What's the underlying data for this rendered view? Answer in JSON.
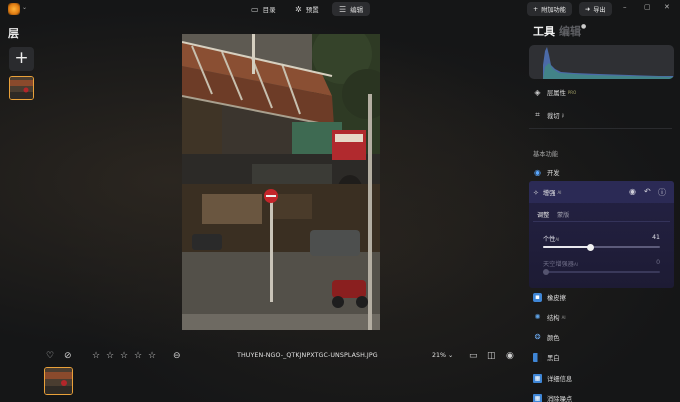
{
  "topbar": {
    "nav": [
      {
        "label": "目录",
        "icon": "catalog-icon"
      },
      {
        "label": "预置",
        "icon": "presets-icon"
      },
      {
        "label": "编辑",
        "icon": "edit-icon"
      }
    ],
    "addon_label": "附加功能",
    "export_label": "导出"
  },
  "left": {
    "title": "层"
  },
  "bottom": {
    "filename": "THUYEN-NGO-_QTKJNPXTGC-UNSPLASH.JPG",
    "zoom": "21% ⌄",
    "stars": 0
  },
  "right": {
    "tab_tools": "工具",
    "tab_edits": "编辑",
    "rows": [
      {
        "label": "层属性",
        "tag": "PRO"
      },
      {
        "label": "裁切",
        "tag": "β"
      }
    ],
    "section": "基本功能",
    "develop": "开发",
    "panel": {
      "title": "增强",
      "tag": "AI",
      "subtabs": [
        "调整",
        "蒙版"
      ],
      "sliders": [
        {
          "label": "个性",
          "tag": "AI",
          "value": "41"
        },
        {
          "label": "天空增强器",
          "tag": "AI",
          "value": "0"
        }
      ]
    },
    "tools": [
      {
        "label": "橡皮擦"
      },
      {
        "label": "结构",
        "tag": "AI"
      },
      {
        "label": "颜色"
      },
      {
        "label": "黑白"
      },
      {
        "label": "详细信息"
      },
      {
        "label": "消除噪点"
      }
    ]
  }
}
